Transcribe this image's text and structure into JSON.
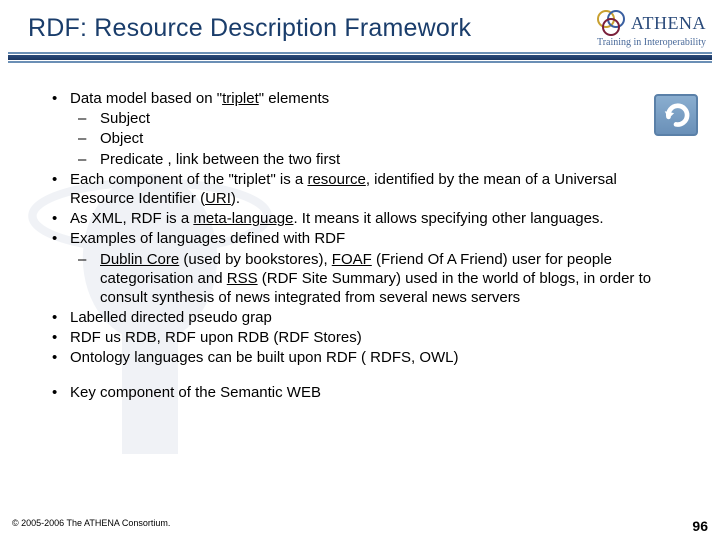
{
  "header": {
    "title": "RDF: Resource Description Framework",
    "logo_text": "ATHENA",
    "tagline": "Training in Interoperability"
  },
  "bullets": [
    {
      "text_parts": [
        "Data model based on \"",
        {
          "u": "triplet"
        },
        "\" elements"
      ],
      "sub": [
        {
          "text": "Subject"
        },
        {
          "text": "Object"
        },
        {
          "text": "Predicate , link between the two first"
        }
      ]
    },
    {
      "text_parts": [
        "Each component of the \"triplet\" is a ",
        {
          "u": "resource"
        },
        ", identified by the mean of a Universal Resource Identifier (",
        {
          "u": "URI"
        },
        ")."
      ]
    },
    {
      "text_parts": [
        "As XML, RDF is a ",
        {
          "u": "meta-language"
        },
        ". It means it allows specifying other languages."
      ]
    },
    {
      "text_parts": [
        "Examples of languages defined with RDF"
      ],
      "sub": [
        {
          "text_parts": [
            {
              "u": "Dublin Core"
            },
            " (used by bookstores), ",
            {
              "u": "FOAF"
            },
            " (Friend Of A Friend) user for people categorisation and  ",
            {
              "u": "RSS"
            },
            " (RDF Site Summary) used in the world of blogs, in order to consult synthesis of news integrated from several news servers"
          ]
        }
      ]
    },
    {
      "text": "Labelled directed pseudo grap"
    },
    {
      "text": "RDF us RDB, RDF upon RDB (RDF Stores)"
    },
    {
      "text": "Ontology languages can be built upon RDF ( RDFS, OWL)"
    },
    {
      "spacer": true
    },
    {
      "text": "Key component of the Semantic WEB"
    }
  ],
  "footer": {
    "copyright": "© 2005-2006 The ATHENA Consortium.",
    "page": "96"
  }
}
